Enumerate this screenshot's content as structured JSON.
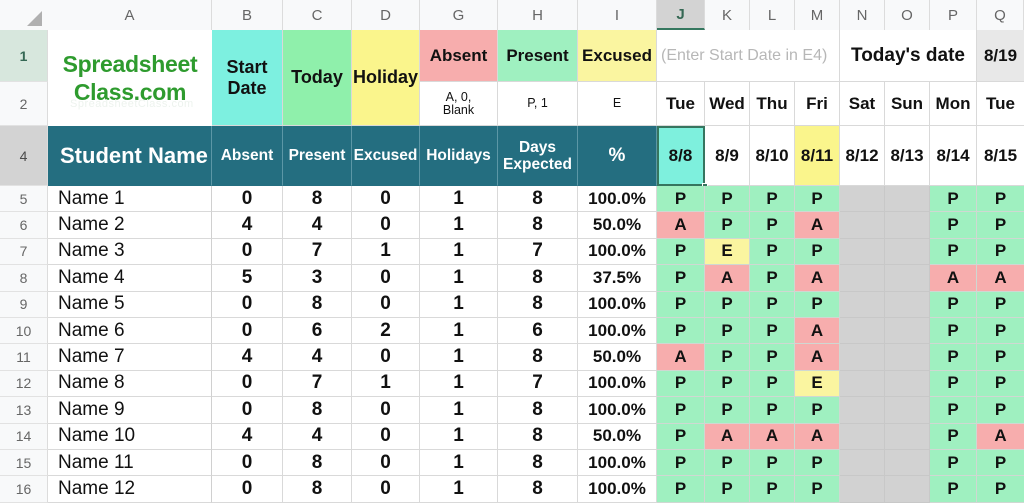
{
  "brand": {
    "line1": "Spreadsheet",
    "line2": "Class.com",
    "color": "#2e9b2e",
    "watermark": "SpreadsheetClass.com"
  },
  "columns": {
    "corner": "",
    "letters": [
      "A",
      "B",
      "C",
      "D",
      "G",
      "H",
      "I",
      "J",
      "K",
      "L",
      "M",
      "N",
      "O",
      "P",
      "Q"
    ],
    "selected_letter": "J"
  },
  "rows": {
    "numbers": [
      "1",
      "2",
      "4",
      "5",
      "6",
      "7",
      "8",
      "9",
      "10",
      "11",
      "12",
      "13",
      "14",
      "15",
      "16"
    ],
    "selected_number": "1",
    "header_number": "4"
  },
  "legend": {
    "start_date_label": "Start\nDate",
    "start_date_l1": "Start",
    "start_date_l2": "Date",
    "today_label": "Today",
    "holiday_label": "Holiday",
    "absent_label": "Absent",
    "absent_codes": "A, 0, Blank",
    "absent_code_l1": "A, 0,",
    "absent_code_l2": "Blank",
    "present_label": "Present",
    "present_codes": "P, 1",
    "excused_label": "Excused",
    "excused_codes": "E"
  },
  "hint_text": "(Enter Start Date in E4)",
  "todays_date": {
    "label": "Today's date",
    "value": "8/19"
  },
  "day_names": [
    "Tue",
    "Wed",
    "Thu",
    "Fri",
    "Sat",
    "Sun",
    "Mon",
    "Tue"
  ],
  "table_headers": {
    "name": "Student Name",
    "absent": "Absent",
    "present": "Present",
    "excused": "Excused",
    "holidays": "Holidays",
    "days_expected_l1": "Days",
    "days_expected_l2": "Expected",
    "percent": "%"
  },
  "dates": [
    "8/8",
    "8/9",
    "8/10",
    "8/11",
    "8/12",
    "8/13",
    "8/14",
    "8/15"
  ],
  "date_cell_styles": [
    "sel",
    "plain",
    "plain",
    "holiday",
    "plain",
    "plain",
    "plain",
    "plain"
  ],
  "students": [
    {
      "row": "5",
      "name": "Name 1",
      "absent": "0",
      "present": "8",
      "excused": "0",
      "holidays": "1",
      "expected": "8",
      "percent": "100.0%",
      "attendance": [
        "P",
        "P",
        "P",
        "P",
        "",
        "",
        "P",
        "P"
      ]
    },
    {
      "row": "6",
      "name": "Name 2",
      "absent": "4",
      "present": "4",
      "excused": "0",
      "holidays": "1",
      "expected": "8",
      "percent": "50.0%",
      "attendance": [
        "A",
        "P",
        "P",
        "A",
        "",
        "",
        "P",
        "P"
      ]
    },
    {
      "row": "7",
      "name": "Name 3",
      "absent": "0",
      "present": "7",
      "excused": "1",
      "holidays": "1",
      "expected": "7",
      "percent": "100.0%",
      "attendance": [
        "P",
        "E",
        "P",
        "P",
        "",
        "",
        "P",
        "P"
      ]
    },
    {
      "row": "8",
      "name": "Name 4",
      "absent": "5",
      "present": "3",
      "excused": "0",
      "holidays": "1",
      "expected": "8",
      "percent": "37.5%",
      "attendance": [
        "P",
        "A",
        "P",
        "A",
        "",
        "",
        "A",
        "A"
      ]
    },
    {
      "row": "9",
      "name": "Name 5",
      "absent": "0",
      "present": "8",
      "excused": "0",
      "holidays": "1",
      "expected": "8",
      "percent": "100.0%",
      "attendance": [
        "P",
        "P",
        "P",
        "P",
        "",
        "",
        "P",
        "P"
      ]
    },
    {
      "row": "10",
      "name": "Name 6",
      "absent": "0",
      "present": "6",
      "excused": "2",
      "holidays": "1",
      "expected": "6",
      "percent": "100.0%",
      "attendance": [
        "P",
        "P",
        "P",
        "A",
        "",
        "",
        "P",
        "P"
      ]
    },
    {
      "row": "11",
      "name": "Name 7",
      "absent": "4",
      "present": "4",
      "excused": "0",
      "holidays": "1",
      "expected": "8",
      "percent": "50.0%",
      "attendance": [
        "A",
        "P",
        "P",
        "A",
        "",
        "",
        "P",
        "P"
      ]
    },
    {
      "row": "12",
      "name": "Name 8",
      "absent": "0",
      "present": "7",
      "excused": "1",
      "holidays": "1",
      "expected": "7",
      "percent": "100.0%",
      "attendance": [
        "P",
        "P",
        "P",
        "E",
        "",
        "",
        "P",
        "P"
      ]
    },
    {
      "row": "13",
      "name": "Name 9",
      "absent": "0",
      "present": "8",
      "excused": "0",
      "holidays": "1",
      "expected": "8",
      "percent": "100.0%",
      "attendance": [
        "P",
        "P",
        "P",
        "P",
        "",
        "",
        "P",
        "P"
      ]
    },
    {
      "row": "14",
      "name": "Name 10",
      "absent": "4",
      "present": "4",
      "excused": "0",
      "holidays": "1",
      "expected": "8",
      "percent": "50.0%",
      "attendance": [
        "P",
        "A",
        "A",
        "A",
        "",
        "",
        "P",
        "A"
      ]
    },
    {
      "row": "15",
      "name": "Name 11",
      "absent": "0",
      "present": "8",
      "excused": "0",
      "holidays": "1",
      "expected": "8",
      "percent": "100.0%",
      "attendance": [
        "P",
        "P",
        "P",
        "P",
        "",
        "",
        "P",
        "P"
      ]
    },
    {
      "row": "16",
      "name": "Name 12",
      "absent": "0",
      "present": "8",
      "excused": "0",
      "holidays": "1",
      "expected": "8",
      "percent": "100.0%",
      "attendance": [
        "P",
        "P",
        "P",
        "P",
        "",
        "",
        "P",
        "P"
      ]
    }
  ],
  "colors": {
    "present": "#9ff0c0",
    "absent": "#f7adad",
    "excused": "#faf5a0",
    "weekend": "#d2d2d2",
    "header": "#246e80",
    "brand": "#2e9b2e",
    "selection": "#36755f",
    "start_date": "#7df0e0",
    "today": "#8ff0ab",
    "holiday": "#faf58c"
  }
}
